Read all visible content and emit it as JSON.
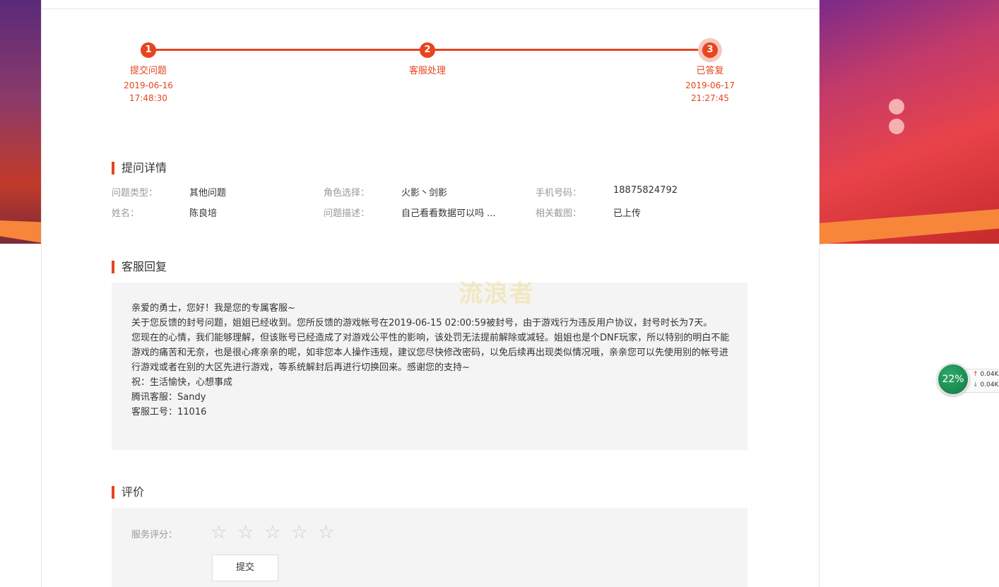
{
  "progress": {
    "steps": [
      {
        "number": "1",
        "label": "提交问题",
        "date": "2019-06-16",
        "time": "17:48:30"
      },
      {
        "number": "2",
        "label": "客服处理",
        "date": "",
        "time": ""
      },
      {
        "number": "3",
        "label": "已答复",
        "date": "2019-06-17",
        "time": "21:27:45"
      }
    ]
  },
  "details": {
    "title": "提问详情",
    "fields": [
      {
        "label": "问题类型：",
        "value": "其他问题"
      },
      {
        "label": "角色选择：",
        "value": "火影丶剑影"
      },
      {
        "label": "手机号码：",
        "value": "18875824792"
      },
      {
        "label": "姓名：",
        "value": "陈良培"
      },
      {
        "label": "问题描述：",
        "value": "自己看看数据可以吗 ..."
      },
      {
        "label": "相关截图：",
        "value": "已上传"
      }
    ]
  },
  "reply": {
    "title": "客服回复",
    "watermark": "流浪者",
    "lines": [
      "亲爱的勇士，您好！我是您的专属客服~",
      "关于您反馈的封号问题，姐姐已经收到。您所反馈的游戏帐号在2019-06-15 02:00:59被封号，由于游戏行为违反用户协议，封号时长为7天。",
      "您现在的心情，我们能够理解，但该账号已经造成了对游戏公平性的影响，该处罚无法提前解除或减轻。姐姐也是个DNF玩家，所以特别的明白不能游戏的痛苦和无奈，也是很心疼亲亲的呢，如非您本人操作违规，建议您尽快修改密码，以免后续再出现类似情况哦，亲亲您可以先使用别的帐号进行游戏或者在别的大区先进行游戏，等系统解封后再进行切换回来。感谢您的支持~",
      "祝：生活愉快，心想事成",
      "腾讯客服：Sandy",
      "客服工号：11016"
    ]
  },
  "evaluation": {
    "title": "评价",
    "rating_label": "服务评分：",
    "rating": 0,
    "max_rating": 5,
    "star_glyph": "☆",
    "submit_label": "提交"
  },
  "net_widget": {
    "percent": "22%",
    "up_arrow": "↑",
    "down_arrow": "↓",
    "up": "0.04K",
    "down": "0.04K"
  },
  "colors": {
    "accent": "#e8441f",
    "panel_bg": "#f4f4f4"
  }
}
